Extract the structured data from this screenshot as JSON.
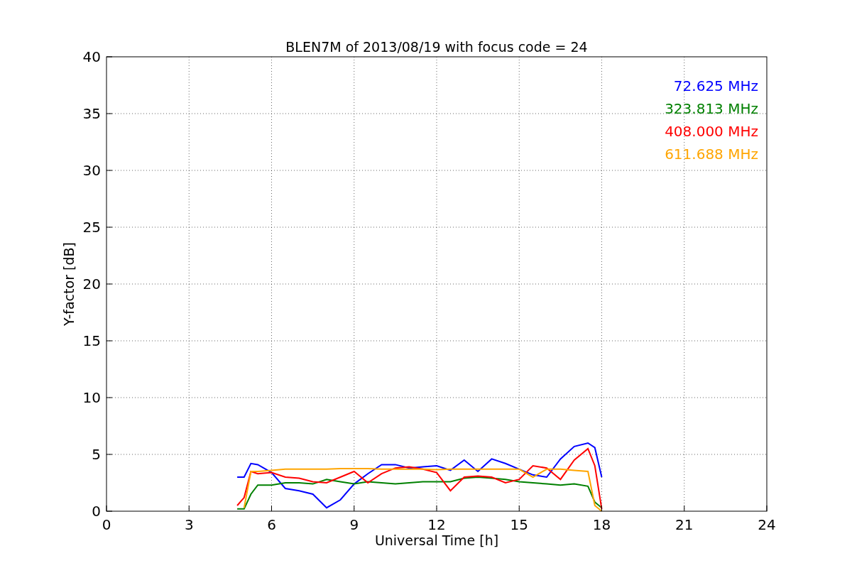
{
  "chart_data": {
    "type": "line",
    "title": "BLEN7M of 2013/08/19 with focus code = 24",
    "xlabel": "Universal Time [h]",
    "ylabel": "Y-factor [dB]",
    "x": [
      4.75,
      5,
      5.25,
      5.5,
      6,
      6.5,
      7,
      7.5,
      8,
      8.5,
      9,
      9.5,
      10,
      10.5,
      11,
      11.5,
      12,
      12.5,
      13,
      13.5,
      14,
      14.5,
      15,
      15.5,
      16,
      16.5,
      17,
      17.5,
      17.75,
      18
    ],
    "series": [
      {
        "name": "72.625 MHz",
        "color": "#0000ff",
        "values": [
          3.0,
          3.0,
          4.2,
          4.1,
          3.4,
          2.0,
          1.8,
          1.5,
          0.3,
          1.0,
          2.4,
          3.3,
          4.1,
          4.1,
          3.8,
          3.9,
          4.0,
          3.6,
          4.5,
          3.5,
          4.6,
          4.2,
          3.7,
          3.2,
          3.0,
          4.6,
          5.7,
          6.0,
          5.6,
          3.0
        ]
      },
      {
        "name": "323.813 MHz",
        "color": "#008000",
        "values": [
          0.2,
          0.2,
          1.5,
          2.3,
          2.3,
          2.5,
          2.5,
          2.4,
          2.8,
          2.6,
          2.4,
          2.6,
          2.5,
          2.4,
          2.5,
          2.6,
          2.6,
          2.6,
          2.9,
          3.0,
          2.9,
          2.8,
          2.6,
          2.5,
          2.4,
          2.3,
          2.4,
          2.2,
          0.8,
          0.3
        ]
      },
      {
        "name": "408.000 MHz",
        "color": "#ff0000",
        "values": [
          0.5,
          1.2,
          3.5,
          3.3,
          3.4,
          3.0,
          2.9,
          2.6,
          2.5,
          3.0,
          3.5,
          2.5,
          3.3,
          3.8,
          3.9,
          3.7,
          3.4,
          1.8,
          3.0,
          3.1,
          3.0,
          2.5,
          2.8,
          4.0,
          3.8,
          2.8,
          4.5,
          5.5,
          4.0,
          0.2
        ]
      },
      {
        "name": "611.688 MHz",
        "color": "#ffa500",
        "values": [
          null,
          0.3,
          3.5,
          3.5,
          3.6,
          3.7,
          3.7,
          3.7,
          3.7,
          3.75,
          3.75,
          3.75,
          3.7,
          3.7,
          3.7,
          3.7,
          3.65,
          3.7,
          3.7,
          3.7,
          3.7,
          3.7,
          3.7,
          3.0,
          3.7,
          3.7,
          3.6,
          3.5,
          0.5,
          0.0
        ]
      }
    ],
    "grid": true,
    "xlim": [
      0,
      24
    ],
    "ylim": [
      0,
      40
    ],
    "xticks": [
      0,
      3,
      6,
      9,
      12,
      15,
      18,
      21,
      24
    ],
    "yticks": [
      0,
      5,
      10,
      15,
      20,
      25,
      30,
      35,
      40
    ]
  }
}
